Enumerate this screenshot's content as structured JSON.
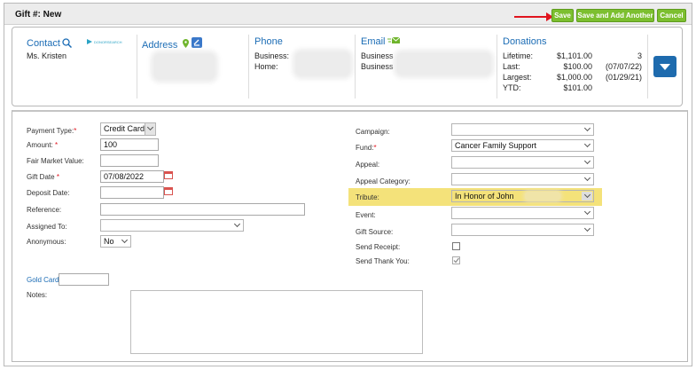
{
  "header": {
    "title": "Gift #: New"
  },
  "toolbar": {
    "save_label": "Save",
    "save_add_label": "Save and Add Another",
    "cancel_label": "Cancel"
  },
  "contact": {
    "heading": "Contact",
    "name": "Ms. Kristen",
    "logo_text": "DONORSEARCH"
  },
  "address": {
    "heading": "Address"
  },
  "phone": {
    "heading": "Phone",
    "business_label": "Business:",
    "home_label": "Home:"
  },
  "email": {
    "heading": "Email",
    "business_label_1": "Business",
    "business_label_2": "Business"
  },
  "donations": {
    "heading": "Donations",
    "rows": [
      {
        "label": "Lifetime:",
        "amount": "$1,101.00",
        "extra": "3"
      },
      {
        "label": "Last:",
        "amount": "$100.00",
        "extra": "(07/07/22)"
      },
      {
        "label": "Largest:",
        "amount": "$1,000.00",
        "extra": "(01/29/21)"
      },
      {
        "label": "YTD:",
        "amount": "$101.00",
        "extra": ""
      }
    ]
  },
  "form": {
    "payment_type": {
      "label": "Payment Type:",
      "value": "Credit Card"
    },
    "amount": {
      "label": "Amount:",
      "value": "100"
    },
    "fair_market": {
      "label": "Fair Market Value:",
      "value": ""
    },
    "gift_date": {
      "label": "Gift Date",
      "value": "07/08/2022"
    },
    "deposit_date": {
      "label": "Deposit Date:",
      "value": ""
    },
    "reference": {
      "label": "Reference:",
      "value": ""
    },
    "assigned_to": {
      "label": "Assigned To:",
      "value": ""
    },
    "anonymous": {
      "label": "Anonymous:",
      "value": "No"
    },
    "campaign": {
      "label": "Campaign:",
      "value": ""
    },
    "fund": {
      "label": "Fund:",
      "value": "Cancer Family Support"
    },
    "appeal": {
      "label": "Appeal:",
      "value": ""
    },
    "appeal_category": {
      "label": "Appeal Category:",
      "value": ""
    },
    "tribute": {
      "label": "Tribute:",
      "value": "In Honor of John"
    },
    "event": {
      "label": "Event:",
      "value": ""
    },
    "gift_source": {
      "label": "Gift Source:",
      "value": ""
    },
    "send_receipt": {
      "label": "Send Receipt:",
      "checked": false
    },
    "send_thank_you": {
      "label": "Send Thank You:",
      "checked": true
    },
    "gold_card": {
      "label": "Gold Card:",
      "value": ""
    },
    "notes": {
      "label": "Notes:",
      "value": ""
    }
  },
  "colors": {
    "accent_green": "#7cbf2f",
    "link_blue": "#1b6cb5",
    "highlight": "#f4e27a",
    "required_red": "#e0141e"
  }
}
